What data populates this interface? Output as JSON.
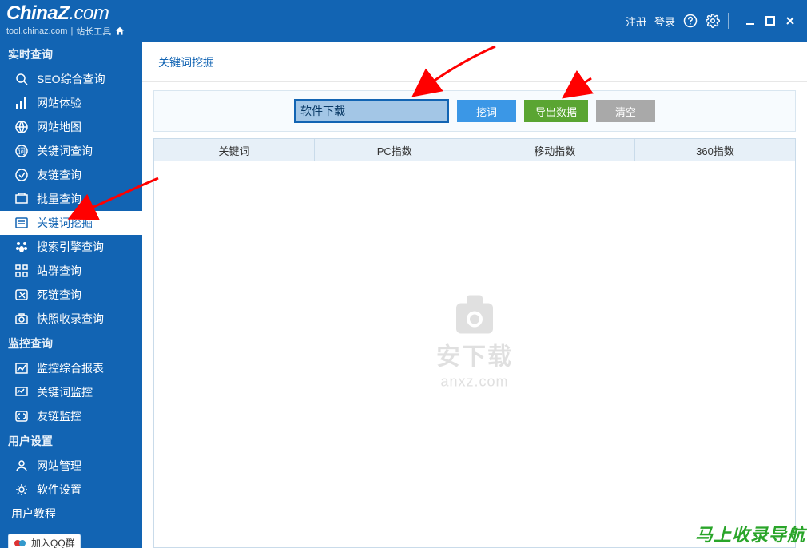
{
  "header": {
    "logo_main": "ChinaZ",
    "logo_suffix": ".com",
    "subdomain": "tool.chinaz.com",
    "subtitle": "站长工具",
    "register": "注册",
    "login": "登录"
  },
  "sidebar": {
    "group1": "实时查询",
    "items1": [
      "SEO综合查询",
      "网站体验",
      "网站地图",
      "关键词查询",
      "友链查询",
      "批量查询",
      "关键词挖掘",
      "搜索引擎查询",
      "站群查询",
      "死链查询",
      "快照收录查询"
    ],
    "group2": "监控查询",
    "items2": [
      "监控综合报表",
      "关键词监控",
      "友链监控"
    ],
    "group3": "用户设置",
    "items3": [
      "网站管理",
      "软件设置"
    ],
    "tutorial": "用户教程",
    "qq": "加入QQ群"
  },
  "main": {
    "title": "关键词挖掘",
    "input_value": "软件下载",
    "btn_dig": "挖词",
    "btn_export": "导出数据",
    "btn_clear": "清空",
    "columns": [
      "关键词",
      "PC指数",
      "移动指数",
      "360指数"
    ]
  },
  "watermark": {
    "line1": "安下载",
    "line2": "anxz.com"
  },
  "footer": {
    "link": "马上收录导航"
  }
}
